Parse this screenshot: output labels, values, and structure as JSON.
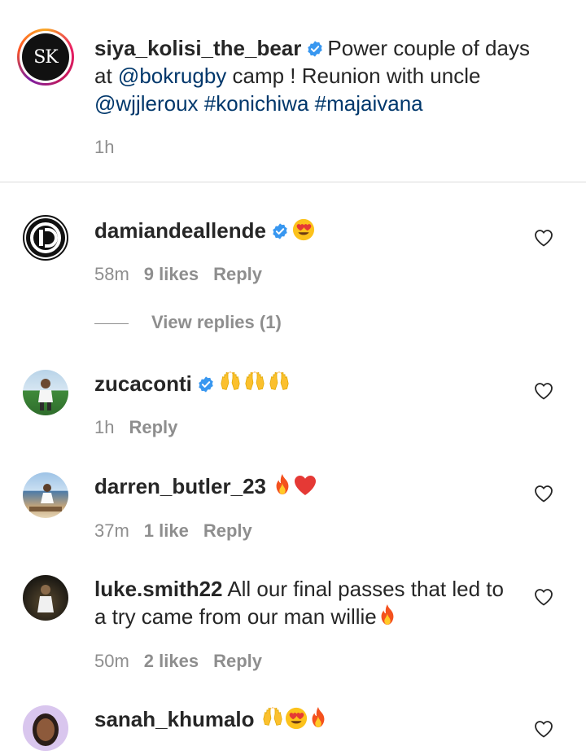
{
  "caption": {
    "avatar_initials": "SK",
    "username": "siya_kolisi_the_bear",
    "text_1": "Power couple of days at ",
    "mention_1": "@bokrugby",
    "text_2": " camp ! Reunion with uncle ",
    "mention_2": "@wjjleroux",
    "text_3": " ",
    "hashtag_1": "#konichiwa",
    "text_4": " ",
    "hashtag_2": "#majaivana",
    "time": "1h"
  },
  "comments": [
    {
      "username": "damiandeallende",
      "verified": true,
      "emojis": [
        "heart-eyes"
      ],
      "text": "",
      "time": "58m",
      "likes": "9 likes",
      "reply": "Reply"
    },
    {
      "username": "zucaconti",
      "verified": true,
      "emojis": [
        "raised-hands",
        "raised-hands",
        "raised-hands"
      ],
      "text": "",
      "time": "1h",
      "likes": "",
      "reply": "Reply"
    },
    {
      "username": "darren_butler_23",
      "verified": false,
      "emojis": [
        "fire",
        "red-heart"
      ],
      "text": "",
      "time": "37m",
      "likes": "1 like",
      "reply": "Reply"
    },
    {
      "username": "luke.smith22",
      "verified": false,
      "emojis": [
        "fire"
      ],
      "text": "All our final passes that led to a try came from our man willie",
      "time": "50m",
      "likes": "2 likes",
      "reply": "Reply"
    },
    {
      "username": "sanah_khumalo",
      "verified": false,
      "emojis": [
        "raised-hands",
        "heart-eyes",
        "fire"
      ],
      "text": "",
      "time": "",
      "likes": "",
      "reply": ""
    }
  ],
  "view_replies": "View replies (1)",
  "colors": {
    "link": "#00376b",
    "meta": "#8e8e8e",
    "verified": "#3897f0",
    "divider": "#dbdbdb"
  }
}
